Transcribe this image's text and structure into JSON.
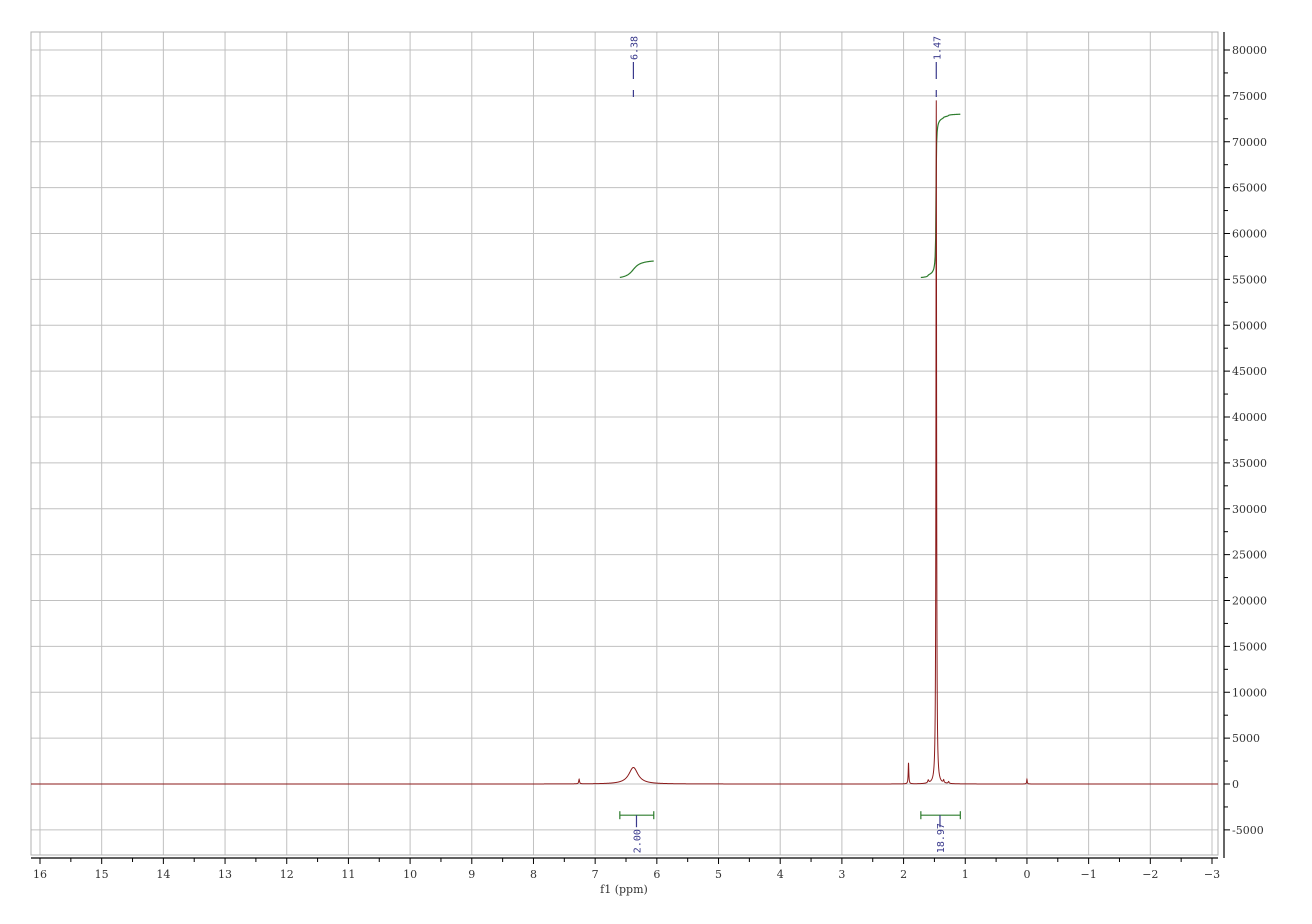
{
  "chart_data": {
    "type": "line",
    "title": "",
    "xlabel": "f1 (ppm)",
    "ylabel": "",
    "xlim": [
      16,
      -3
    ],
    "ylim": [
      -7500,
      82000
    ],
    "x_ticks": [
      16,
      15,
      14,
      13,
      12,
      11,
      10,
      9,
      8,
      7,
      6,
      5,
      4,
      3,
      2,
      1,
      0,
      -1,
      -2,
      -3
    ],
    "x_tick_labels": [
      "16",
      "15",
      "14",
      "13",
      "12",
      "11",
      "10",
      "9",
      "8",
      "7",
      "6",
      "5",
      "4",
      "3",
      "2",
      "1",
      "0",
      "−1",
      "−2",
      "−3"
    ],
    "y_ticks": [
      80000,
      75000,
      70000,
      65000,
      60000,
      55000,
      50000,
      45000,
      40000,
      35000,
      30000,
      25000,
      20000,
      15000,
      10000,
      5000,
      0,
      -5000
    ],
    "y_tick_labels": [
      "80000",
      "75000",
      "70000",
      "65000",
      "60000",
      "55000",
      "50000",
      "45000",
      "40000",
      "35000",
      "30000",
      "25000",
      "20000",
      "15000",
      "10000",
      "5000",
      "0",
      "-5000"
    ],
    "grid": true,
    "spectrum_peaks": [
      {
        "ppm": 7.26,
        "height": 500,
        "width": 0.008
      },
      {
        "ppm": 6.38,
        "height": 1800,
        "width": 0.09
      },
      {
        "ppm": 1.92,
        "height": 2300,
        "width": 0.006
      },
      {
        "ppm": 1.6,
        "height": 300,
        "width": 0.01
      },
      {
        "ppm": 1.47,
        "height": 74500,
        "width": 0.006
      },
      {
        "ppm": 1.35,
        "height": 300,
        "width": 0.008
      },
      {
        "ppm": 1.27,
        "height": 200,
        "width": 0.01
      },
      {
        "ppm": 0.0,
        "height": 500,
        "width": 0.006
      }
    ],
    "peak_labels": [
      {
        "ppm": 6.38,
        "label": "6.38"
      },
      {
        "ppm": 1.47,
        "label": "1.47"
      }
    ],
    "integrals": [
      {
        "from": 6.6,
        "to": 6.05,
        "center": 6.33,
        "value": "2.00",
        "curve_start": 55200,
        "curve_end": 57000
      },
      {
        "from": 1.72,
        "to": 1.08,
        "center": 1.41,
        "value": "18.97",
        "curve_start": 55200,
        "curve_end": 73000
      }
    ],
    "colors": {
      "spectrum": "#8b1a1a",
      "integral": "#2e7d2e",
      "label": "#3a3a8c",
      "grid": "#c0c0c0"
    }
  }
}
